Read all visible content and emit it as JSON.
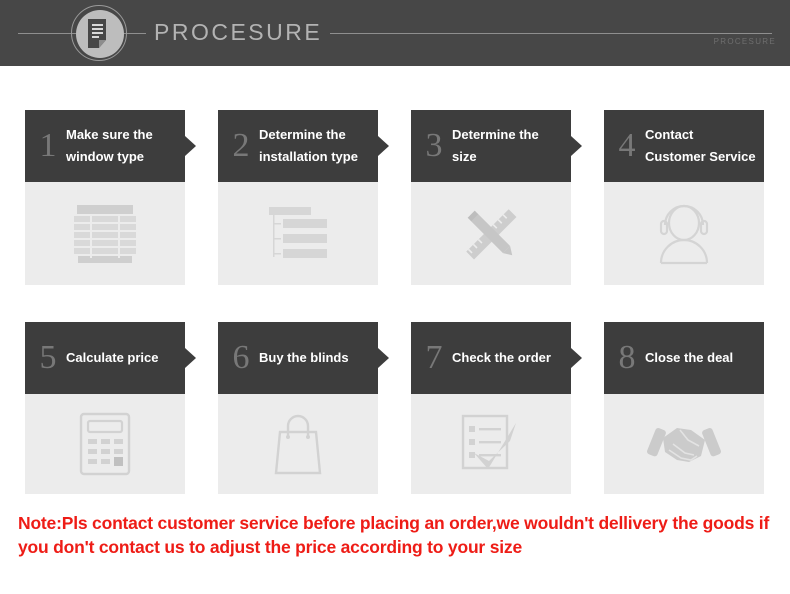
{
  "header": {
    "title": "PROCESURE",
    "watermark": "PROCESURE",
    "logo_icon": "document-icon",
    "background_color": "#474747",
    "title_color": "#b3b3b3"
  },
  "steps": [
    {
      "number": "1",
      "label_line1": "Make sure the",
      "label_line2": "window type",
      "icon": "window-blinds-icon",
      "has_arrow": true
    },
    {
      "number": "2",
      "label_line1": "Determine the",
      "label_line2": "installation type",
      "icon": "hierarchy-list-icon",
      "has_arrow": true
    },
    {
      "number": "3",
      "label_line1": "Determine the",
      "label_line2": "size",
      "icon": "ruler-pencil-icon",
      "has_arrow": true
    },
    {
      "number": "4",
      "label_line1": "Contact",
      "label_line2": "Customer Service",
      "icon": "headset-support-icon",
      "has_arrow": false
    },
    {
      "number": "5",
      "label_line1": "Calculate price",
      "label_line2": "",
      "icon": "calculator-icon",
      "has_arrow": true
    },
    {
      "number": "6",
      "label_line1": "Buy the blinds",
      "label_line2": "",
      "icon": "shopping-bag-icon",
      "has_arrow": true
    },
    {
      "number": "7",
      "label_line1": "Check the order",
      "label_line2": "",
      "icon": "checklist-icon",
      "has_arrow": true
    },
    {
      "number": "8",
      "label_line1": "Close the deal",
      "label_line2": "",
      "icon": "handshake-icon",
      "has_arrow": false
    }
  ],
  "note": {
    "text": "Note:Pls contact customer service before placing an order,we wouldn't dellivery the goods if you don't contact us to adjust the price according to your size",
    "color": "#ee1c16"
  },
  "theme": {
    "card_header_color": "#3d3d3d",
    "card_body_color": "#ececec",
    "icon_color": "#d2d2d2",
    "number_color": "#787878"
  }
}
